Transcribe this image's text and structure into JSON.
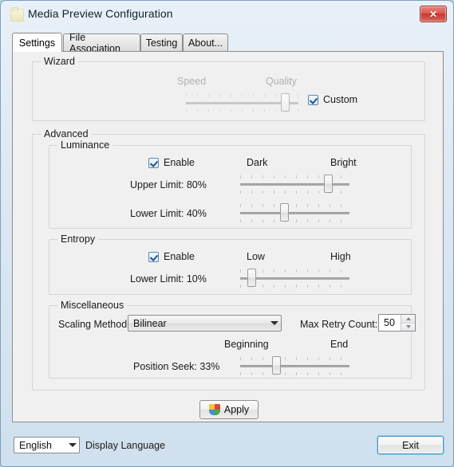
{
  "window": {
    "title": "Media Preview Configuration",
    "icon": "folder-icon",
    "close_label": "✕"
  },
  "tabs": [
    {
      "label": "Settings",
      "active": true
    },
    {
      "label": "File Association",
      "active": false
    },
    {
      "label": "Testing",
      "active": false
    },
    {
      "label": "About...",
      "active": false
    }
  ],
  "wizard": {
    "group_label": "Wizard",
    "left_label": "Speed",
    "right_label": "Quality",
    "slider_percent": 88,
    "enabled": false,
    "custom_checkbox": {
      "label": "Custom",
      "checked": true
    }
  },
  "advanced": {
    "group_label": "Advanced",
    "luminance": {
      "group_label": "Luminance",
      "enable_checkbox": {
        "label": "Enable",
        "checked": true
      },
      "left_label": "Dark",
      "right_label": "Bright",
      "upper": {
        "label": "Upper Limit: 80%",
        "value": 80
      },
      "lower": {
        "label": "Lower Limit: 40%",
        "value": 40
      }
    },
    "entropy": {
      "group_label": "Entropy",
      "enable_checkbox": {
        "label": "Enable",
        "checked": true
      },
      "left_label": "Low",
      "right_label": "High",
      "lower": {
        "label": "Lower Limit: 10%",
        "value": 10
      }
    },
    "miscellaneous": {
      "group_label": "Miscellaneous",
      "scaling_method": {
        "label": "Scaling Method:",
        "value": "Bilinear"
      },
      "max_retry_count": {
        "label": "Max Retry Count:",
        "value": "50"
      },
      "position_seek": {
        "label": "Position Seek: 33%",
        "left_label": "Beginning",
        "right_label": "End",
        "value": 33
      }
    }
  },
  "apply_button": {
    "label": "Apply",
    "icon": "uac-shield-icon"
  },
  "footer": {
    "language_select": {
      "value": "English"
    },
    "language_label": "Display Language",
    "exit_button": {
      "label": "Exit"
    }
  }
}
